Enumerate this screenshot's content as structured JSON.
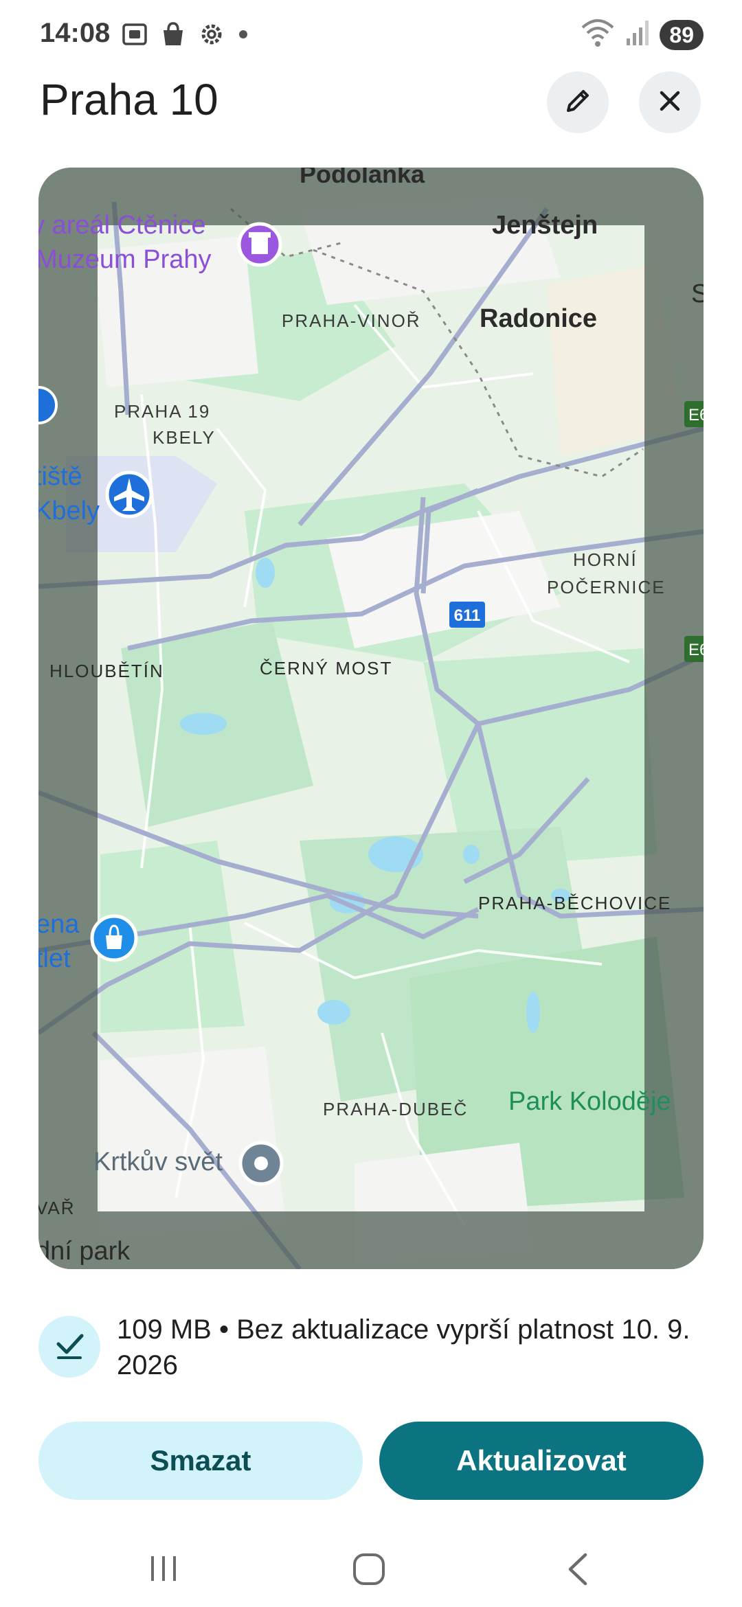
{
  "status_bar": {
    "time": "14:08",
    "battery": "89",
    "icons": [
      "screenshot-icon",
      "shopping-bag-icon",
      "settings-icon",
      "dot-icon",
      "wifi-icon",
      "signal-icon"
    ]
  },
  "header": {
    "title": "Praha 10",
    "edit_icon": "pencil-icon",
    "close_icon": "close-icon"
  },
  "map": {
    "labels": {
      "podolanka": "Podolanka",
      "jenstejn": "Jenštejn",
      "radonice": "Radonice",
      "areal": "y areál Ctěnice",
      "muzeum": "Muzeum Prahy",
      "vinor": "PRAHA-VINOŘ",
      "praha19": "PRAHA 19",
      "kbely": "KBELY",
      "letiste": "tiště",
      "kbely2": "Kbely",
      "horni": "HORNÍ",
      "pocernice": "POČERNICE",
      "road611": "611",
      "hloubetin": "HLOUBĚTÍN",
      "cerny_most": "ČERNÝ MOST",
      "bechovice": "PRAHA-BĚCHOVICE",
      "ena": "ena",
      "tlet": "tlet",
      "dubec": "PRAHA-DUBEČ",
      "park": "Park Koloděje",
      "krtkuv": "Krtkův svět",
      "var": "VAŘ",
      "dni_park": "dní park",
      "e_route1": "E6",
      "e_route2": "E6",
      "edge_s": "S"
    }
  },
  "download": {
    "icon": "download-done-icon",
    "info": "109 MB • Bez aktualizace vyprší platnost 10. 9. 2026"
  },
  "actions": {
    "delete_label": "Smazat",
    "update_label": "Aktualizovat"
  },
  "nav": {
    "icons": [
      "recent-apps-icon",
      "home-icon",
      "back-icon"
    ]
  }
}
